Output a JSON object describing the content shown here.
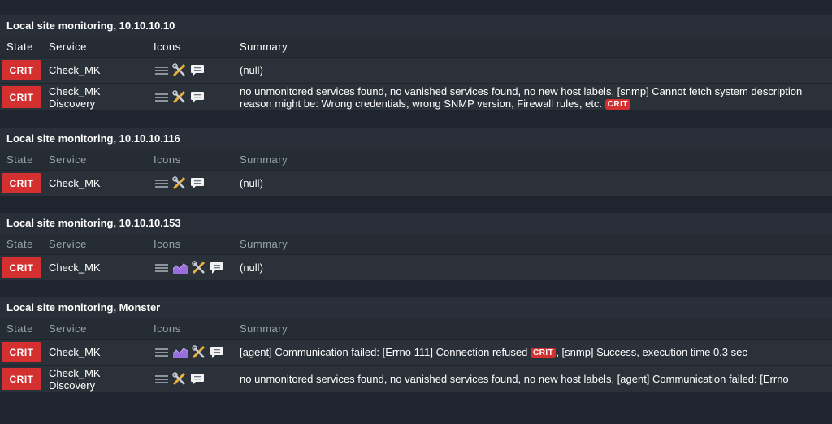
{
  "headers": {
    "state": "State",
    "service": "Service",
    "icons": "Icons",
    "summary": "Summary"
  },
  "groups": [
    {
      "title": "Local site monitoring, 10.10.10.10",
      "rows": [
        {
          "state": "CRIT",
          "service": [
            "Check_MK"
          ],
          "icons": [
            "menu-icon",
            "wrench-icon",
            "comment-icon"
          ],
          "summary": [
            "(null)"
          ]
        },
        {
          "state": "CRIT",
          "service": [
            "Check_MK",
            "Discovery"
          ],
          "icons": [
            "menu-icon",
            "wrench-icon",
            "comment-icon"
          ],
          "summary": [
            "no unmonitored services found, no vanished services found, no new host labels, [snmp] Cannot fetch system description",
            "reason might be: Wrong credentials, wrong SNMP version, Firewall rules, etc."
          ],
          "summary_badge": "CRIT"
        }
      ]
    },
    {
      "title": "Local site monitoring, 10.10.10.116",
      "rows": [
        {
          "state": "CRIT",
          "service": [
            "Check_MK"
          ],
          "icons": [
            "menu-icon",
            "wrench-icon",
            "comment-icon"
          ],
          "summary": [
            "(null)"
          ]
        }
      ]
    },
    {
      "title": "Local site monitoring, 10.10.10.153",
      "rows": [
        {
          "state": "CRIT",
          "service": [
            "Check_MK"
          ],
          "icons": [
            "menu-icon",
            "graph-icon",
            "wrench-icon",
            "comment-icon"
          ],
          "summary": [
            "(null)"
          ]
        }
      ]
    },
    {
      "title": "Local site monitoring, Monster",
      "rows": [
        {
          "state": "CRIT",
          "service": [
            "Check_MK"
          ],
          "icons": [
            "menu-icon",
            "graph-icon",
            "wrench-icon",
            "comment-icon"
          ],
          "summary_parts": [
            "[agent] Communication failed: [Errno 111] Connection refused",
            "CRIT",
            ", [snmp] Success, execution time 0.3 sec"
          ]
        },
        {
          "state": "CRIT",
          "service": [
            "Check_MK",
            "Discovery"
          ],
          "icons": [
            "menu-icon",
            "wrench-icon",
            "comment-icon"
          ],
          "summary": [
            "no unmonitored services found, no vanished services found, no new host labels, [agent] Communication failed: [Errno"
          ]
        }
      ]
    }
  ],
  "colors": {
    "crit": "#d3302f",
    "background": "#1f252e",
    "row": "#2a3139"
  }
}
